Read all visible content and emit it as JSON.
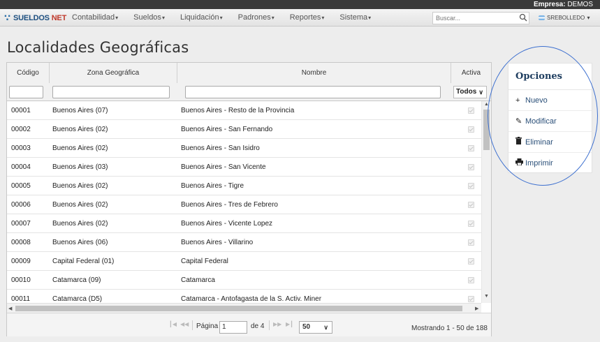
{
  "header": {
    "empresa_label": "Empresa:",
    "empresa_value": "DEMOS",
    "brand_name": "SUELDOS",
    "brand_suffix": "NET",
    "menu": [
      "Contabilidad",
      "Sueldos",
      "Liquidación",
      "Padrones",
      "Reportes",
      "Sistema"
    ],
    "search_placeholder": "Buscar...",
    "user": "SREBOLLEDO"
  },
  "page": {
    "title": "Localidades Geográficas"
  },
  "table": {
    "columns": [
      "Código",
      "Zona Geográfica",
      "Nombre",
      "Activa"
    ],
    "activa_filter": "Todos",
    "rows": [
      {
        "codigo": "00001",
        "zona": "Buenos Aires (07)",
        "nombre": "Buenos Aires - Resto de la Provincia",
        "activa": true
      },
      {
        "codigo": "00002",
        "zona": "Buenos Aires (02)",
        "nombre": "Buenos Aires - San Fernando",
        "activa": true
      },
      {
        "codigo": "00003",
        "zona": "Buenos Aires (02)",
        "nombre": "Buenos Aires - San Isidro",
        "activa": true
      },
      {
        "codigo": "00004",
        "zona": "Buenos Aires (03)",
        "nombre": "Buenos Aires - San Vicente",
        "activa": true
      },
      {
        "codigo": "00005",
        "zona": "Buenos Aires (02)",
        "nombre": "Buenos Aires - Tigre",
        "activa": true
      },
      {
        "codigo": "00006",
        "zona": "Buenos Aires (02)",
        "nombre": "Buenos Aires - Tres de Febrero",
        "activa": true
      },
      {
        "codigo": "00007",
        "zona": "Buenos Aires (02)",
        "nombre": "Buenos Aires - Vicente Lopez",
        "activa": true
      },
      {
        "codigo": "00008",
        "zona": "Buenos Aires (06)",
        "nombre": "Buenos Aires - Villarino",
        "activa": true
      },
      {
        "codigo": "00009",
        "zona": "Capital Federal (01)",
        "nombre": "Capital Federal",
        "activa": true
      },
      {
        "codigo": "00010",
        "zona": "Catamarca (09)",
        "nombre": "Catamarca",
        "activa": true
      },
      {
        "codigo": "00011",
        "zona": "Catamarca (D5)",
        "nombre": "Catamarca - Antofagasta de la S. Activ. Miner",
        "activa": true
      }
    ]
  },
  "pager": {
    "page_label": "Página",
    "page_value": "1",
    "of_label": "de 4",
    "per_page": "50",
    "summary": "Mostrando 1 - 50 de 188"
  },
  "options": {
    "title": "Opciones",
    "items": [
      {
        "icon": "plus-icon",
        "label": "Nuevo"
      },
      {
        "icon": "pencil-icon",
        "label": "Modificar"
      },
      {
        "icon": "trash-icon",
        "label": "Eliminar"
      },
      {
        "icon": "print-icon",
        "label": "Imprimir"
      }
    ]
  }
}
